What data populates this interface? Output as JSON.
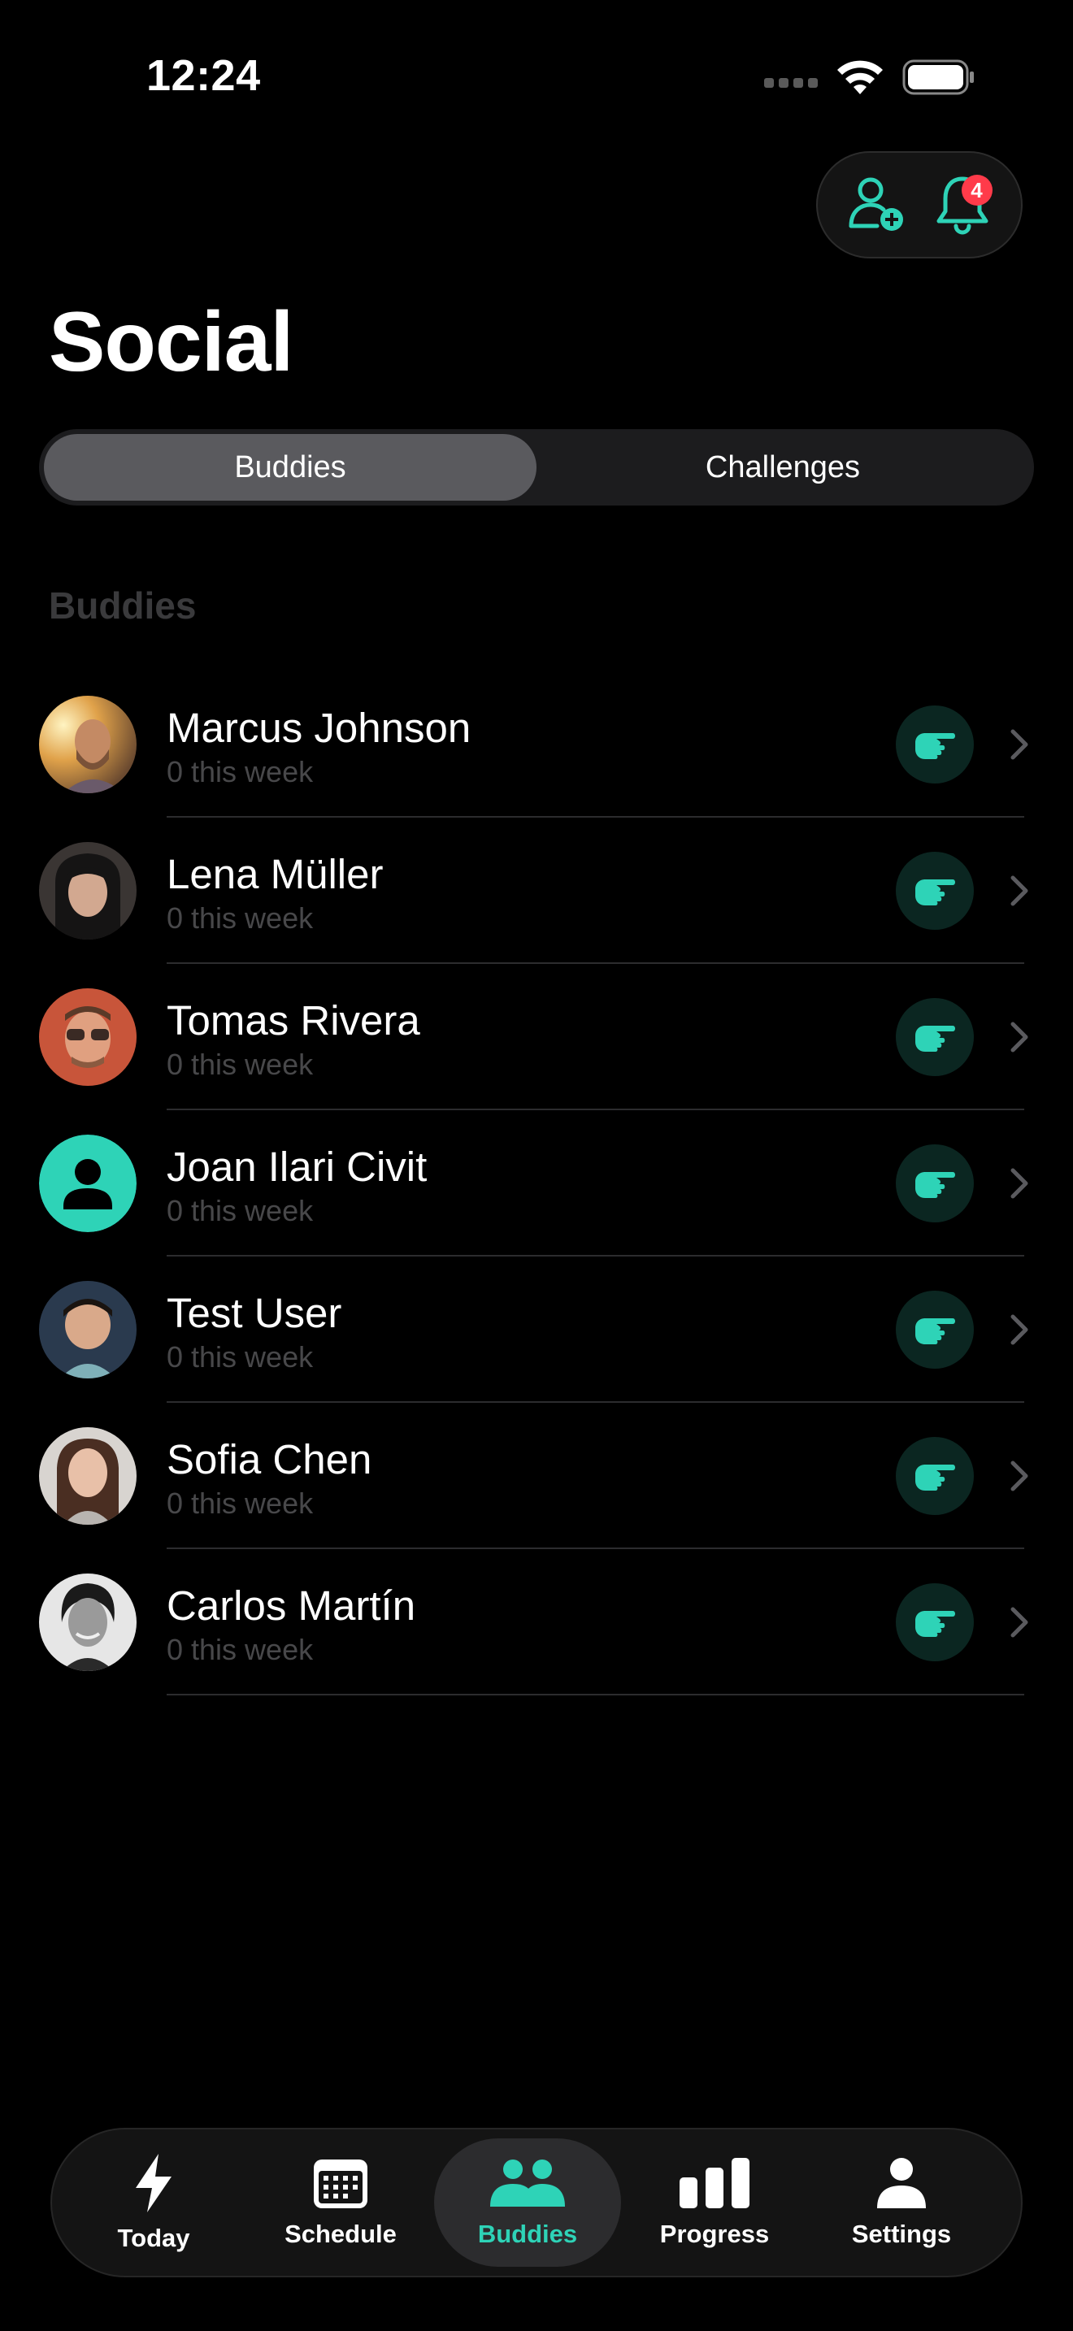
{
  "status": {
    "time": "12:24"
  },
  "header": {
    "notification_count": "4"
  },
  "page": {
    "title": "Social"
  },
  "segmented": {
    "tabs": [
      "Buddies",
      "Challenges"
    ],
    "selected": "Buddies"
  },
  "section": {
    "title": "Buddies"
  },
  "buddies": [
    {
      "name": "Marcus Johnson",
      "subtitle": "0 this week",
      "avatar": "photo"
    },
    {
      "name": "Lena Müller",
      "subtitle": "0 this week",
      "avatar": "photo"
    },
    {
      "name": "Tomas Rivera",
      "subtitle": "0 this week",
      "avatar": "photo"
    },
    {
      "name": "Joan Ilari Civit",
      "subtitle": "0 this week",
      "avatar": "default-person-icon"
    },
    {
      "name": "Test User",
      "subtitle": "0 this week",
      "avatar": "photo"
    },
    {
      "name": "Sofia Chen",
      "subtitle": "0 this week",
      "avatar": "photo"
    },
    {
      "name": "Carlos Martín",
      "subtitle": "0 this week",
      "avatar": "photo"
    }
  ],
  "tabbar": {
    "items": [
      {
        "label": "Today",
        "icon": "bolt-icon"
      },
      {
        "label": "Schedule",
        "icon": "calendar-icon"
      },
      {
        "label": "Buddies",
        "icon": "people-icon"
      },
      {
        "label": "Progress",
        "icon": "bar-chart-icon"
      },
      {
        "label": "Settings",
        "icon": "person-icon"
      }
    ],
    "selected": "Buddies"
  },
  "colors": {
    "accent": "#2ed3b7",
    "badge": "#ff3b4a",
    "background": "#000000"
  }
}
